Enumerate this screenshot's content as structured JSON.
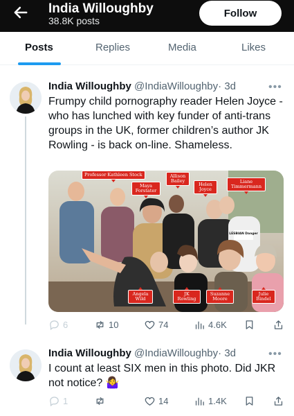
{
  "header": {
    "name": "India Willoughby",
    "posts": "38.8K posts",
    "follow_label": "Follow"
  },
  "tabs": [
    {
      "label": "Posts"
    },
    {
      "label": "Replies"
    },
    {
      "label": "Media"
    },
    {
      "label": "Likes"
    }
  ],
  "tweets": [
    {
      "author": "India Willoughby",
      "handle": "@IndiaWilloughby",
      "time": "· 3d",
      "text": "Frumpy child pornography reader Helen Joyce - who has lunched with key funder of anti-trans groups in the UK,  former children’s author JK Rowling - is back on-line. Shameless.",
      "photo_labels": [
        "Professor Kathleen Stock",
        "Maya Forstater",
        "Allison Bailey",
        "Helen Joyce",
        "Liane Timmermann",
        "Angela Wild",
        "JK Rowling",
        "Suzanne Moore",
        "Julie Bindel"
      ],
      "shirt_text": "LESBIAN Danger",
      "replies": "6",
      "reposts": "10",
      "likes": "74",
      "views": "4.6K"
    },
    {
      "author": "India Willoughby",
      "handle": "@IndiaWilloughby",
      "time": "· 3d",
      "text": "I count at least SIX men in this photo. Did JKR not notice? 🤷‍♀️",
      "replies": "1",
      "reposts": "",
      "likes": "14",
      "views": "1.4K"
    }
  ]
}
